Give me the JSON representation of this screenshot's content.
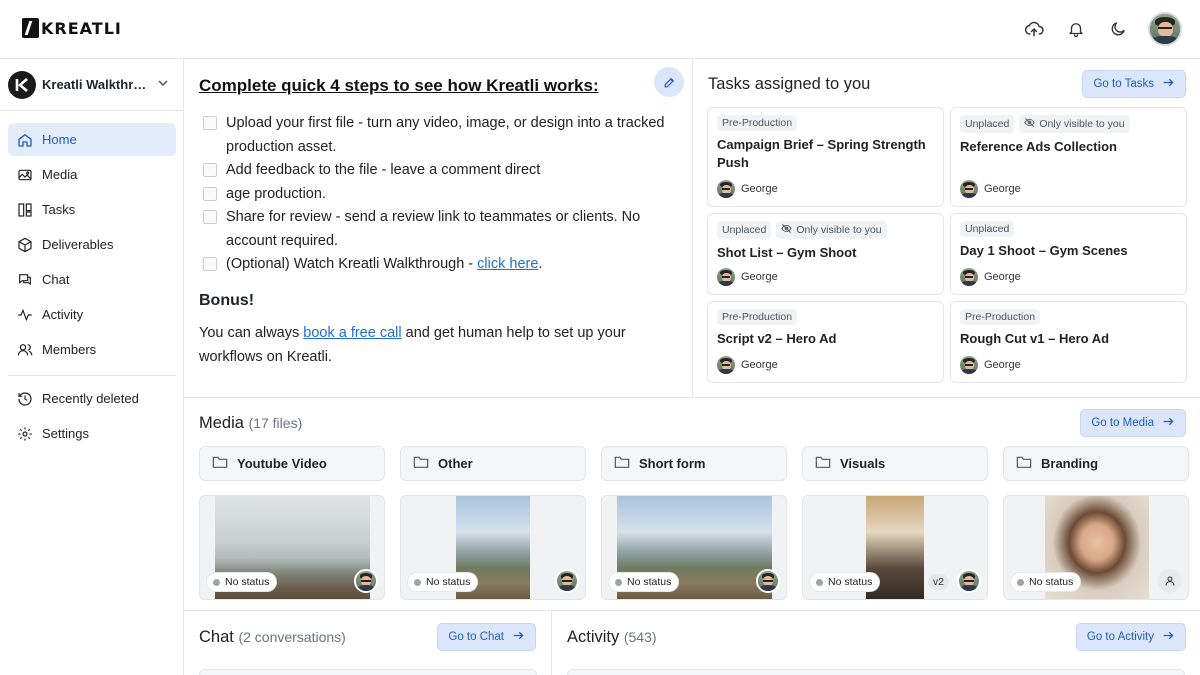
{
  "brand": {
    "name": "KREATLI"
  },
  "topbar": {
    "icons": [
      "cloud-upload-icon",
      "bell-icon",
      "moon-icon"
    ]
  },
  "workspace": {
    "name": "Kreatli Walkthrough",
    "initial": "K"
  },
  "sidebar": {
    "items": [
      {
        "label": "Home",
        "icon": "home-icon",
        "active": true
      },
      {
        "label": "Media",
        "icon": "media-icon"
      },
      {
        "label": "Tasks",
        "icon": "tasks-icon"
      },
      {
        "label": "Deliverables",
        "icon": "box-icon"
      },
      {
        "label": "Chat",
        "icon": "chat-icon"
      },
      {
        "label": "Activity",
        "icon": "activity-icon"
      },
      {
        "label": "Members",
        "icon": "members-icon"
      }
    ],
    "secondary": [
      {
        "label": "Recently deleted",
        "icon": "history-icon"
      },
      {
        "label": "Settings",
        "icon": "gear-icon"
      }
    ]
  },
  "steps": {
    "title": "Complete quick 4 steps to see how Kreatli works:",
    "items": [
      {
        "text": "Upload your first file - turn any video, image, or design into a tracked production asset."
      },
      {
        "text": "Add feedback to the file - leave a comment direct"
      },
      {
        "text": "age production."
      },
      {
        "text": "Share for review - send a review link to teammates or clients. No account required."
      }
    ],
    "optional_prefix": "(Optional) Watch Kreatli Walkthrough - ",
    "optional_link": "click here",
    "optional_suffix": ".",
    "bonus_title": "Bonus!",
    "bonus_prefix": "You can always ",
    "bonus_link": "book a free call",
    "bonus_suffix": " and get human help to set up your workflows on Kreatli."
  },
  "tasks": {
    "title": "Tasks assigned to you",
    "go_label": "Go to Tasks",
    "cards": [
      {
        "tags": [
          "Pre-Production"
        ],
        "title": "Campaign Brief – Spring Strength Push",
        "assignee": "George"
      },
      {
        "tags": [
          "Unplaced",
          "Only visible to you"
        ],
        "title": "Reference Ads Collection",
        "assignee": "George"
      },
      {
        "tags": [
          "Unplaced",
          "Only visible to you"
        ],
        "title": "Shot List – Gym Shoot",
        "assignee": "George"
      },
      {
        "tags": [
          "Unplaced"
        ],
        "title": "Day 1 Shoot – Gym Scenes",
        "assignee": "George"
      },
      {
        "tags": [
          "Pre-Production"
        ],
        "title": "Script v2 – Hero Ad",
        "assignee": "George"
      },
      {
        "tags": [
          "Pre-Production"
        ],
        "title": "Rough Cut v1 – Hero Ad",
        "assignee": "George"
      }
    ]
  },
  "media": {
    "title": "Media",
    "count": "(17 files)",
    "go_label": "Go to Media",
    "folders": [
      "Youtube Video",
      "Other",
      "Short form",
      "Visuals",
      "Branding"
    ],
    "files": [
      {
        "status": "No status"
      },
      {
        "status": "No status"
      },
      {
        "status": "No status"
      },
      {
        "status": "No status",
        "version": "v2"
      },
      {
        "status": "No status"
      }
    ]
  },
  "chat": {
    "title": "Chat",
    "count": "(2 conversations)",
    "go_label": "Go to Chat"
  },
  "activity": {
    "title": "Activity",
    "count": "(543)",
    "go_label": "Go to Activity"
  },
  "colors": {
    "accent": "#1f5fbf",
    "accent_bg": "#dbe6fb",
    "link": "#1f6fd6"
  }
}
